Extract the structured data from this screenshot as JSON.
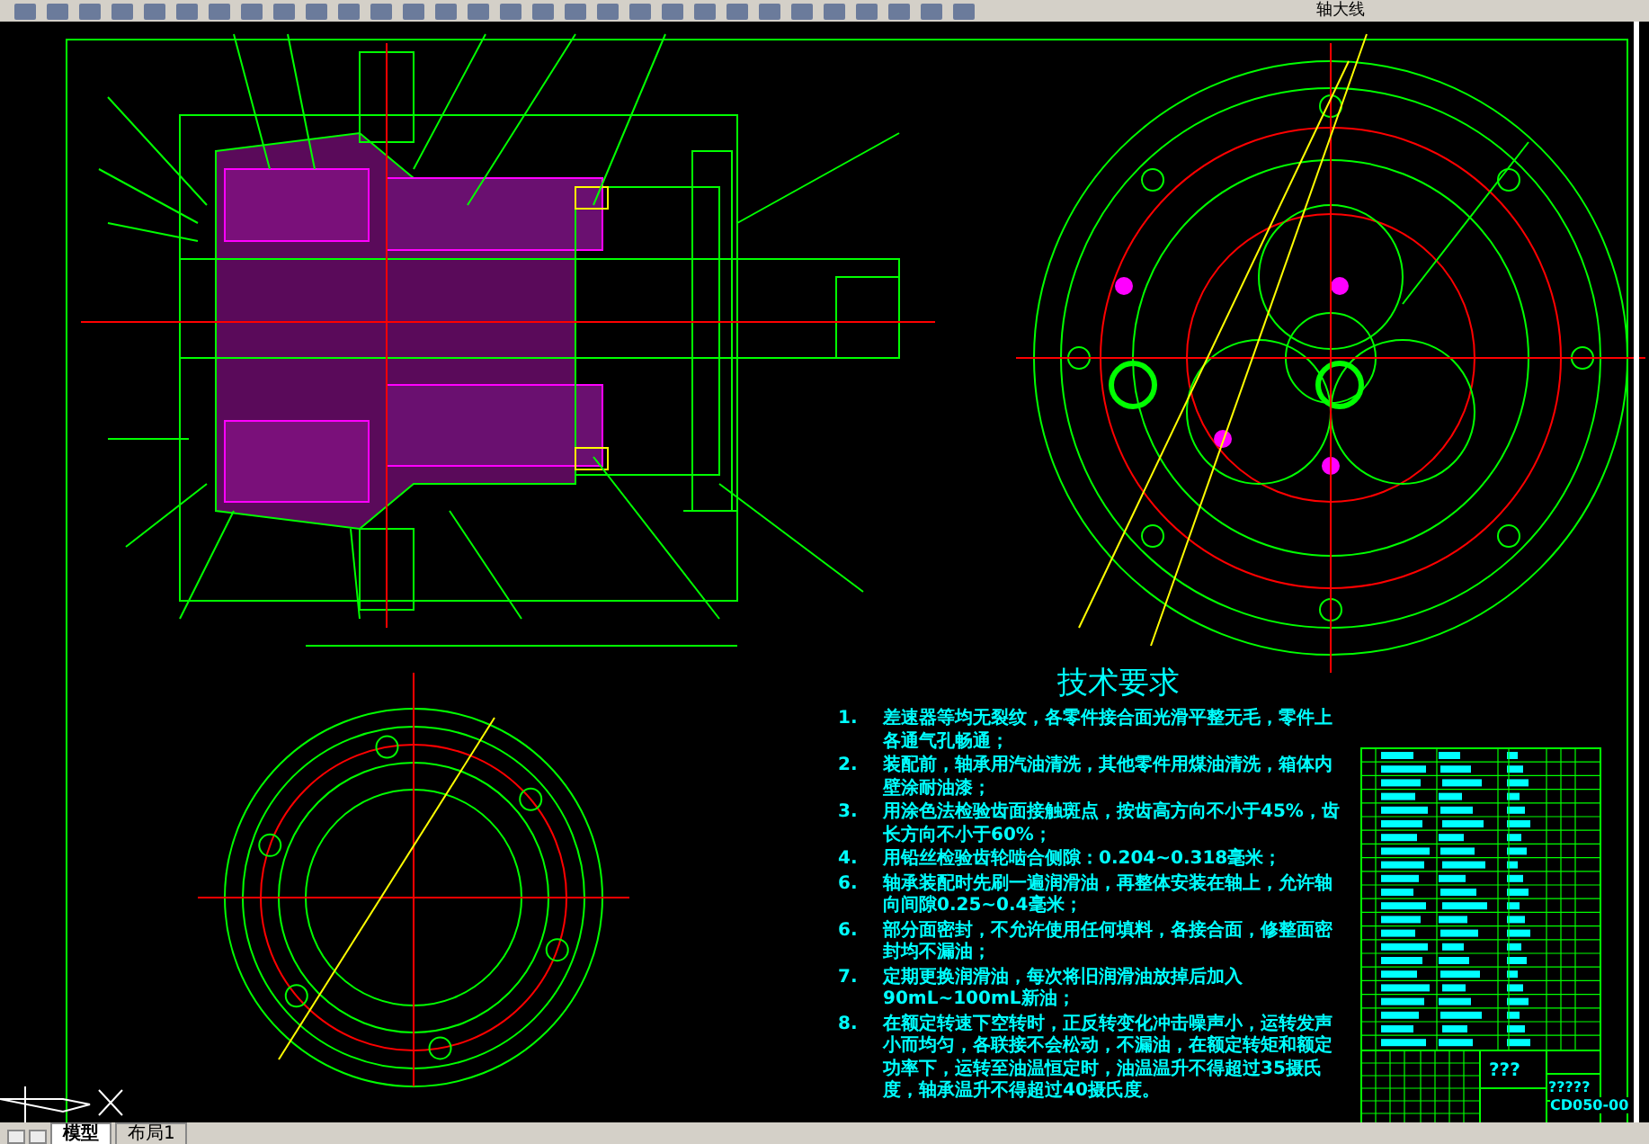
{
  "toolbar": {
    "layer_name": "轴大线"
  },
  "requirements": {
    "title": "技术要求",
    "items": [
      {
        "number": "1.",
        "text": "差速器等均无裂纹，各零件接合面光滑平整无毛，零件上各通气孔畅通；"
      },
      {
        "number": "2.",
        "text": "装配前，轴承用汽油清洗，其他零件用煤油清洗，箱体内壁涂耐油漆；"
      },
      {
        "number": "3.",
        "text": "用涂色法检验齿面接触斑点，按齿高方向不小于45%，齿长方向不小于60%；"
      },
      {
        "number": "4.",
        "text": "用铅丝检验齿轮啮合侧隙：0.204~0.318毫米；"
      },
      {
        "number": "6.",
        "text": "轴承装配时先刷一遍润滑油，再整体安装在轴上，允许轴向间隙0.25~0.4毫米；"
      },
      {
        "number": "6.",
        "text": "部分面密封，不允许使用任何填料，各接合面，修整面密封均不漏油；"
      },
      {
        "number": "7.",
        "text": "定期更换润滑油，每次将旧润滑油放掉后加入90mL~100mL新油；"
      },
      {
        "number": "8.",
        "text": "在额定转速下空转时，正反转变化冲击噪声小，运转发声小而均匀，各联接不会松动，不漏油，在额定转矩和额定功率下，运转至油温恒定时，油温温升不得超过35摄氏度，轴承温升不得超过40摄氏度。"
      }
    ]
  },
  "title_block": {
    "name": "???",
    "company": "?????",
    "drawing_number": "CD050-00"
  },
  "tabs": [
    {
      "label": "模型",
      "selected": true
    },
    {
      "label": "布局1",
      "selected": false
    }
  ]
}
